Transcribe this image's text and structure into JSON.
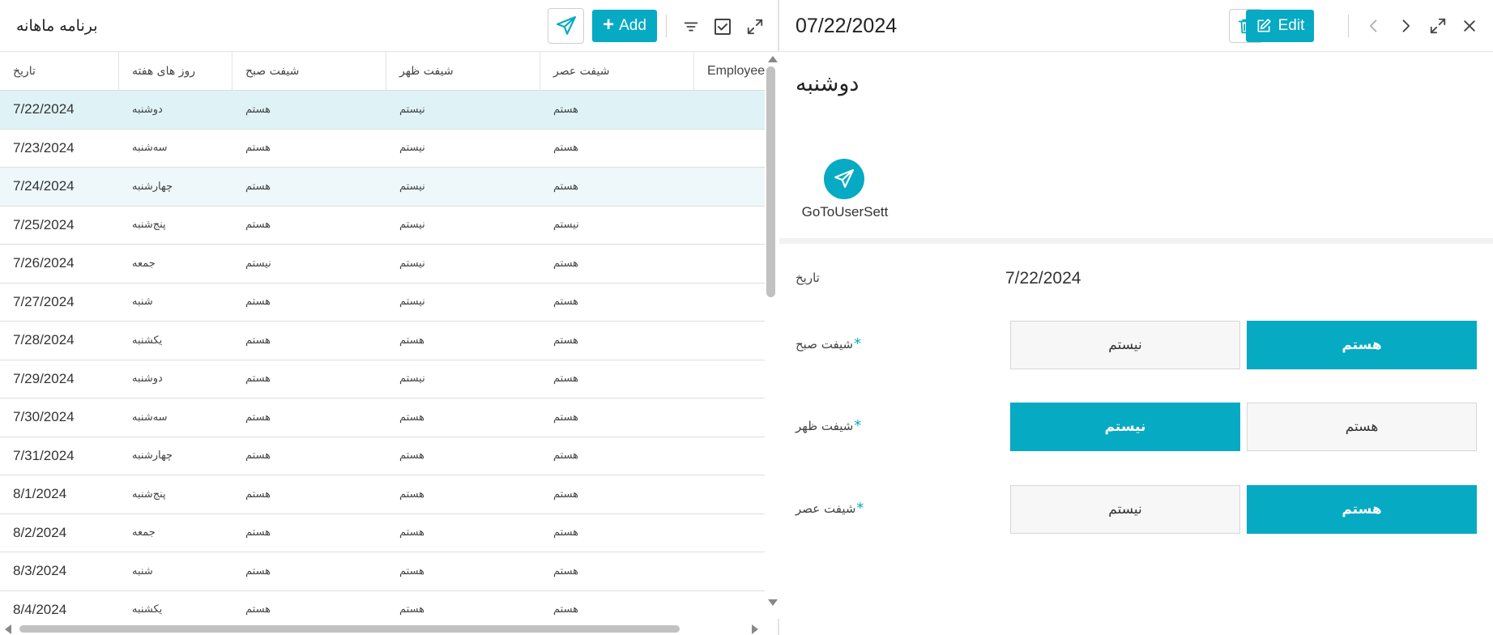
{
  "list": {
    "title": "برنامه ماهانه",
    "add_label": "Add",
    "columns": [
      "تاریخ",
      "روز های هفته",
      "شیفت صبح",
      "شیفت ظهر",
      "شیفت عصر",
      "Employee"
    ],
    "rows": [
      {
        "date": "7/22/2024",
        "day": "دوشنبه",
        "morning": "هستم",
        "noon": "نیستم",
        "evening": "هستم"
      },
      {
        "date": "7/23/2024",
        "day": "سه‌شنبه",
        "morning": "هستم",
        "noon": "نیستم",
        "evening": "هستم"
      },
      {
        "date": "7/24/2024",
        "day": "چهارشنبه",
        "morning": "هستم",
        "noon": "نیستم",
        "evening": "هستم"
      },
      {
        "date": "7/25/2024",
        "day": "پنج‌شنبه",
        "morning": "هستم",
        "noon": "نیستم",
        "evening": "نیستم"
      },
      {
        "date": "7/26/2024",
        "day": "جمعه",
        "morning": "نیستم",
        "noon": "نیستم",
        "evening": "هستم"
      },
      {
        "date": "7/27/2024",
        "day": "شنبه",
        "morning": "هستم",
        "noon": "نیستم",
        "evening": "هستم"
      },
      {
        "date": "7/28/2024",
        "day": "یکشنبه",
        "morning": "هستم",
        "noon": "هستم",
        "evening": "هستم"
      },
      {
        "date": "7/29/2024",
        "day": "دوشنبه",
        "morning": "هستم",
        "noon": "نیستم",
        "evening": "هستم"
      },
      {
        "date": "7/30/2024",
        "day": "سه‌شنبه",
        "morning": "هستم",
        "noon": "هستم",
        "evening": "هستم"
      },
      {
        "date": "7/31/2024",
        "day": "چهارشنبه",
        "morning": "هستم",
        "noon": "هستم",
        "evening": "هستم"
      },
      {
        "date": "8/1/2024",
        "day": "پنج‌شنبه",
        "morning": "هستم",
        "noon": "هستم",
        "evening": "هستم"
      },
      {
        "date": "8/2/2024",
        "day": "جمعه",
        "morning": "هستم",
        "noon": "هستم",
        "evening": "هستم"
      },
      {
        "date": "8/3/2024",
        "day": "شنبه",
        "morning": "هستم",
        "noon": "هستم",
        "evening": "هستم"
      },
      {
        "date": "8/4/2024",
        "day": "یکشنبه",
        "morning": "هستم",
        "noon": "هستم",
        "evening": "هستم"
      }
    ]
  },
  "detail": {
    "title": "07/22/2024",
    "edit_label": "Edit",
    "day_heading": "دوشنبه",
    "action_label": "GoToUserSett",
    "date_label": "تاریخ",
    "date_value": "7/22/2024",
    "fields": [
      {
        "label": "شیفت صبح",
        "left": "نیستم",
        "right": "هستم",
        "active": "right"
      },
      {
        "label": "شیفت ظهر",
        "left": "نیستم",
        "right": "هستم",
        "active": "left"
      },
      {
        "label": "شیفت عصر",
        "left": "نیستم",
        "right": "هستم",
        "active": "right"
      }
    ]
  },
  "icons": {
    "send": "paper-plane-icon",
    "filter": "filter-icon",
    "check": "checkbox-icon",
    "expand": "expand-icon",
    "delete": "trash-icon",
    "edit": "edit-icon",
    "prev": "chevron-left-icon",
    "next": "chevron-right-icon",
    "close": "close-icon"
  },
  "colors": {
    "accent": "#06aac3",
    "selected_row": "#dff3f7"
  }
}
